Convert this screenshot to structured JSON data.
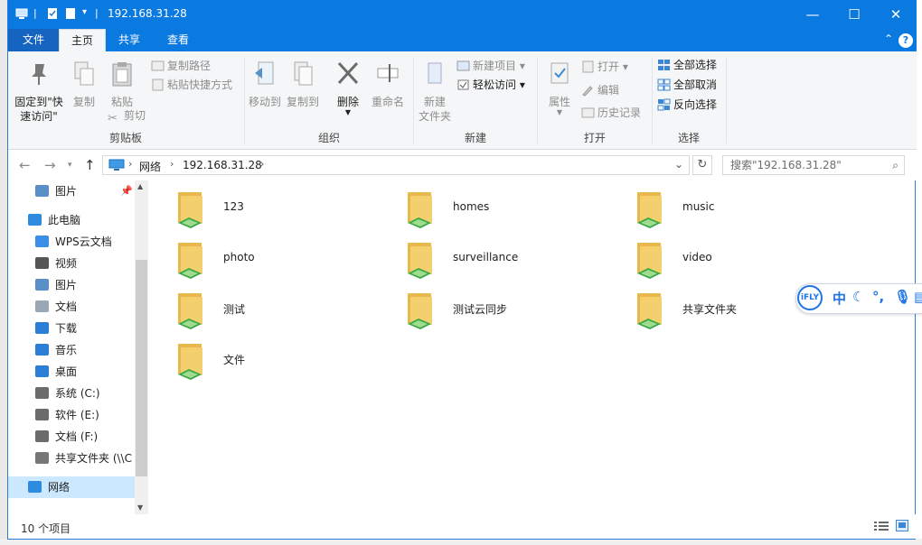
{
  "window": {
    "title": "192.168.31.28",
    "buttons": {
      "minimize": "—",
      "maximize": "☐",
      "close": "✕"
    }
  },
  "ribbon": {
    "tabs": [
      "文件",
      "主页",
      "共享",
      "查看"
    ],
    "active_tab": "主页",
    "groups": {
      "clipboard": {
        "label": "剪贴板",
        "pin_label": "固定到\"快\n速访问\"",
        "copy_label": "复制",
        "paste_label": "粘贴",
        "copy_path_label": "复制路径",
        "paste_shortcut_label": "粘贴快捷方式",
        "cut_label": "剪切"
      },
      "organize": {
        "label": "组织",
        "move_to_label": "移动到",
        "copy_to_label": "复制到",
        "delete_label": "删除",
        "rename_label": "重命名"
      },
      "new": {
        "label": "新建",
        "new_folder_label": "新建\n文件夹",
        "new_item_label": "新建项目",
        "easy_access_label": "轻松访问"
      },
      "open": {
        "label": "打开",
        "properties_label": "属性",
        "open_label": "打开",
        "edit_label": "编辑",
        "history_label": "历史记录"
      },
      "select": {
        "label": "选择",
        "select_all_label": "全部选择",
        "select_none_label": "全部取消",
        "invert_label": "反向选择"
      }
    }
  },
  "address": {
    "crumbs": [
      "网络",
      "192.168.31.28"
    ],
    "search_placeholder": "搜索\"192.168.31.28\""
  },
  "nav": {
    "items": [
      {
        "label": "图片",
        "icon": "pictures-icon"
      },
      {
        "label": "此电脑",
        "icon": "computer-icon"
      },
      {
        "label": "WPS云文档",
        "icon": "cloud-icon"
      },
      {
        "label": "视频",
        "icon": "video-icon"
      },
      {
        "label": "图片",
        "icon": "pictures-icon"
      },
      {
        "label": "文档",
        "icon": "documents-icon"
      },
      {
        "label": "下载",
        "icon": "download-icon"
      },
      {
        "label": "音乐",
        "icon": "music-icon"
      },
      {
        "label": "桌面",
        "icon": "desktop-icon"
      },
      {
        "label": "系统 (C:)",
        "icon": "drive-icon"
      },
      {
        "label": "软件 (E:)",
        "icon": "drive-icon"
      },
      {
        "label": "文档 (F:)",
        "icon": "drive-icon"
      },
      {
        "label": "共享文件夹 (\\\\C",
        "icon": "network-drive-icon"
      },
      {
        "label": "网络",
        "icon": "network-icon"
      }
    ],
    "selected": "网络"
  },
  "content": {
    "folders": [
      "123",
      "homes",
      "music",
      "photo",
      "surveillance",
      "video",
      "测试",
      "测试云同步",
      "共享文件夹",
      "文件"
    ]
  },
  "status": {
    "item_count": "10 个项目"
  },
  "ime": {
    "logo": "iFLY",
    "lang": "中"
  },
  "colors": {
    "accent": "#0a7ae0",
    "folder": "#f4cf6d",
    "share_green": "#39a845",
    "selection": "#cce8ff"
  }
}
